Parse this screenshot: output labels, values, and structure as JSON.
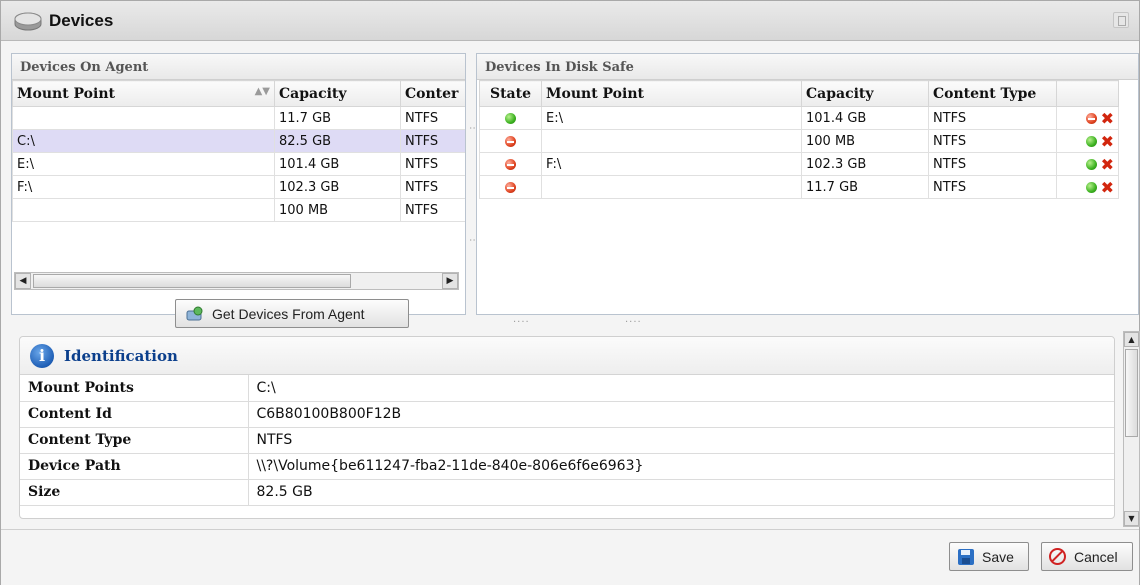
{
  "window": {
    "title": "Devices",
    "icon": "hard-drive-icon"
  },
  "agent_panel": {
    "title": "Devices On Agent",
    "columns": [
      "Mount Point",
      "Capacity",
      "Conter"
    ],
    "rows": [
      {
        "mount": "",
        "capacity": "11.7 GB",
        "content": "NTFS"
      },
      {
        "mount": "C:\\",
        "capacity": "82.5 GB",
        "content": "NTFS"
      },
      {
        "mount": "E:\\",
        "capacity": "101.4 GB",
        "content": "NTFS"
      },
      {
        "mount": "F:\\",
        "capacity": "102.3 GB",
        "content": "NTFS"
      },
      {
        "mount": "",
        "capacity": "100 MB",
        "content": "NTFS"
      }
    ],
    "get_button": "Get Devices From Agent"
  },
  "disksafe_panel": {
    "title": "Devices In Disk Safe",
    "columns": [
      "State",
      "Mount Point",
      "Capacity",
      "Content Type",
      ""
    ],
    "rows": [
      {
        "state": "green",
        "mount": "E:\\",
        "capacity": "101.4 GB",
        "content": "NTFS",
        "toggle": "red"
      },
      {
        "state": "red",
        "mount": "",
        "capacity": "100 MB",
        "content": "NTFS",
        "toggle": "green"
      },
      {
        "state": "red",
        "mount": "F:\\",
        "capacity": "102.3 GB",
        "content": "NTFS",
        "toggle": "green"
      },
      {
        "state": "red",
        "mount": "",
        "capacity": "11.7 GB",
        "content": "NTFS",
        "toggle": "green"
      }
    ]
  },
  "identification": {
    "title": "Identification",
    "props": [
      {
        "key": "Mount Points",
        "value": "C:\\"
      },
      {
        "key": "Content Id",
        "value": "C6B80100B800F12B"
      },
      {
        "key": "Content Type",
        "value": "NTFS"
      },
      {
        "key": "Device Path",
        "value": "\\\\?\\Volume{be611247-fba2-11de-840e-806e6f6e6963}"
      },
      {
        "key": "Size",
        "value": "82.5 GB"
      }
    ]
  },
  "footer": {
    "save": "Save",
    "cancel": "Cancel"
  }
}
